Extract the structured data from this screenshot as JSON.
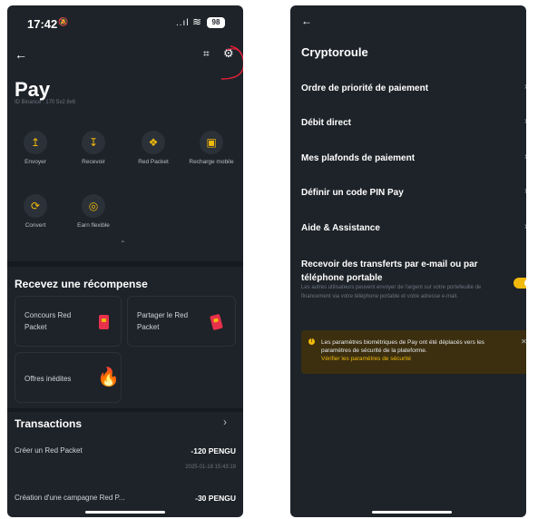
{
  "left": {
    "status": {
      "time": "17:42",
      "bell": "🔕",
      "signal": "..ıl",
      "wifi": "≋",
      "battery": "98"
    },
    "header": {
      "back": "←",
      "scan": "⌗",
      "settings": "⚙"
    },
    "title": "Pay",
    "uid": "ID Binance : 170 5x2 8x6",
    "actions": [
      {
        "icon": "↥",
        "label": "Envoyer"
      },
      {
        "icon": "↧",
        "label": "Recevoir"
      },
      {
        "icon": "❖",
        "label": "Red Packet"
      },
      {
        "icon": "▣",
        "label": "Recharge mobile"
      },
      {
        "icon": "⟳",
        "label": "Convert"
      },
      {
        "icon": "◎",
        "label": "Earn flexible"
      }
    ],
    "collapse": "⌃",
    "rewards": {
      "title": "Recevez une récompense",
      "cards": [
        {
          "label": "Concours Red Packet"
        },
        {
          "label": "Partager le Red Packet"
        },
        {
          "label": "Offres inédites"
        }
      ]
    },
    "transactions": {
      "title": "Transactions",
      "chevron": "›",
      "rows": [
        {
          "label": "Créer un Red Packet",
          "amount": "-120 PENGU",
          "date": "2025-01-18 15:43:19"
        },
        {
          "label": "Création d'une campagne Red P...",
          "amount": "-30 PENGU",
          "date": ""
        }
      ]
    }
  },
  "right": {
    "back": "←",
    "title": "Cryptoroule",
    "chevron": "›",
    "items": [
      {
        "label": "Ordre de priorité de paiement"
      },
      {
        "label": "Débit direct"
      },
      {
        "label": "Mes plafonds de paiement"
      },
      {
        "label": "Définir un code PIN Pay"
      },
      {
        "label": "Aide & Assistance"
      }
    ],
    "transfer": {
      "title_line1": "Recevoir des transferts par e-mail ou par",
      "title_line2": "téléphone portable",
      "desc": "Les autres utilisateurs peuvent envoyer de l'argent sur votre portefeuille de financement via votre téléphone portable et votre adresse e-mail.",
      "enabled": true
    },
    "notice": {
      "icon": "!",
      "text": "Les paramètres biométriques de Pay ont été déplacés vers les paramètres de sécurité de la plateforme.",
      "link": "Vérifier les paramètres de sécurité",
      "close": "✕"
    }
  },
  "colors": {
    "background": "#1e2329",
    "accent": "#f0b90b",
    "annotation": "#e8203a"
  }
}
